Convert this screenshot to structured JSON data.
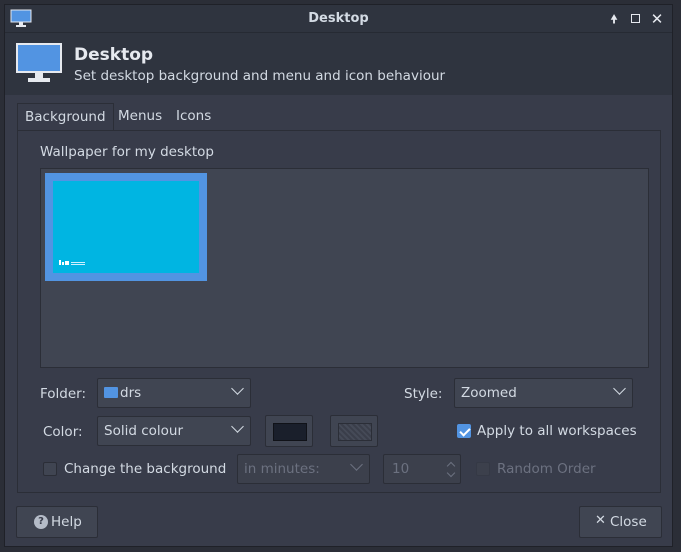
{
  "window": {
    "title": "Desktop"
  },
  "header": {
    "title": "Desktop",
    "subtitle": "Set desktop background and menu and icon behaviour"
  },
  "tabs": [
    {
      "label": "Background",
      "active": true
    },
    {
      "label": "Menus",
      "active": false
    },
    {
      "label": "Icons",
      "active": false
    }
  ],
  "background": {
    "wallpaper_label": "Wallpaper for my desktop",
    "folder_label": "Folder:",
    "folder_value": "drs",
    "style_label": "Style:",
    "style_value": "Zoomed",
    "color_label": "Color:",
    "color_value": "Solid colour",
    "primary_color": "#1a1f2b",
    "secondary_color": "#404552",
    "apply_all_label": "Apply to all workspaces",
    "apply_all_checked": true,
    "change_bg_label": "Change the background",
    "change_bg_checked": false,
    "interval_value": "in minutes:",
    "interval_number": "10",
    "random_label": "Random Order",
    "random_checked": false
  },
  "buttons": {
    "help": "Help",
    "close": "Close"
  },
  "colors": {
    "accent": "#5294e2",
    "wallpaper": "#00b5e2"
  }
}
